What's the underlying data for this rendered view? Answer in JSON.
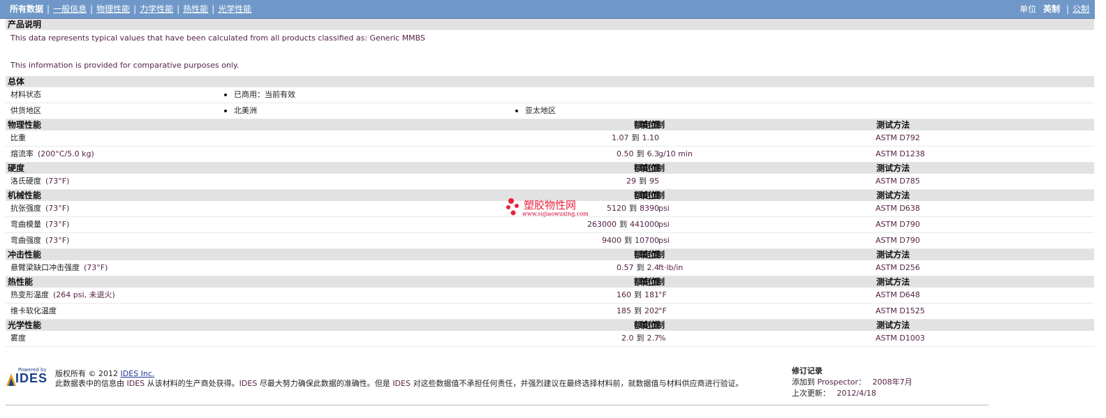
{
  "nav": {
    "items": [
      "所有数据",
      "一般信息",
      "物理性能",
      "力学性能",
      "热性能",
      "光学性能"
    ],
    "units_label": "单位",
    "unit_imperial": "英制",
    "unit_metric": "公制"
  },
  "product_desc": {
    "title": "产品说明",
    "line1": "This data represents typical values that have been calculated from all products classified as: Generic MMBS",
    "line2": "This information is provided for comparative purposes only."
  },
  "general": {
    "title": "总体",
    "status_label": "材料状态",
    "status_value": "已商用：当前有效",
    "region_label": "供货地区",
    "regions": [
      "北美洲",
      "亚太地区"
    ]
  },
  "headers": {
    "nominal": "额定值",
    "unit": "单位制",
    "method": "测试方法"
  },
  "to": "到",
  "sections": [
    {
      "title": "物理性能",
      "rows": [
        {
          "label": "比重",
          "cond": "",
          "low": "1.07",
          "high": "1.10",
          "unit": "",
          "method": "ASTM D792"
        },
        {
          "label": "熔流率",
          "cond": "(200°C/5.0 kg)",
          "low": "0.50",
          "high": "6.3",
          "unit": "g/10 min",
          "method": "ASTM D1238"
        }
      ]
    },
    {
      "title": "硬度",
      "rows": [
        {
          "label": "洛氏硬度",
          "cond": "(73°F)",
          "low": "29",
          "high": "95",
          "unit": "",
          "method": "ASTM D785"
        }
      ]
    },
    {
      "title": "机械性能",
      "rows": [
        {
          "label": "抗张强度",
          "cond": "(73°F)",
          "low": "5120",
          "high": "8390",
          "unit": "psi",
          "method": "ASTM D638"
        },
        {
          "label": "弯曲模量",
          "cond": "(73°F)",
          "low": "263000",
          "high": "441000",
          "unit": "psi",
          "method": "ASTM D790"
        },
        {
          "label": "弯曲强度",
          "cond": "(73°F)",
          "low": "9400",
          "high": "10700",
          "unit": "psi",
          "method": "ASTM D790"
        }
      ]
    },
    {
      "title": "冲击性能",
      "rows": [
        {
          "label": "悬臂梁缺口冲击强度",
          "cond": "(73°F)",
          "low": "0.57",
          "high": "2.4",
          "unit": "ft·lb/in",
          "method": "ASTM D256"
        }
      ]
    },
    {
      "title": "热性能",
      "rows": [
        {
          "label": "热变形温度",
          "cond": "(264 psi, 未退火)",
          "low": "160",
          "high": "181",
          "unit": "°F",
          "method": "ASTM D648"
        },
        {
          "label": "维卡软化温度",
          "cond": "",
          "low": "185",
          "high": "202",
          "unit": "°F",
          "method": "ASTM D1525"
        }
      ]
    },
    {
      "title": "光学性能",
      "rows": [
        {
          "label": "雾度",
          "cond": "",
          "low": "2.0",
          "high": "2.7",
          "unit": "%",
          "method": "ASTM D1003"
        }
      ]
    }
  ],
  "watermark": {
    "text": "塑胶物性网",
    "url": "www.sujiaowuxing.com"
  },
  "footer": {
    "logo_powered": "Powered by",
    "logo_text": "IDES",
    "copyright_prefix": "版权所有 © 2012",
    "copyright_link": "IDES Inc.",
    "disclaimer_a": "此数据表中的信息由",
    "ides": "IDES",
    "disclaimer_b": "从该材料的生产商处获得。",
    "disclaimer_c": "尽最大努力确保此数据的准确性。但是",
    "disclaimer_d": "对这些数据值不承担任何责任，并强烈建议在最终选择材料前，就数据值与材料供应商进行验证。",
    "rev_title": "修订记录",
    "added_label": "添加到",
    "added_target": "Prospector：",
    "added_date": "2008年7月",
    "updated_label": "上次更新：",
    "updated_date": "2012/4/18"
  }
}
